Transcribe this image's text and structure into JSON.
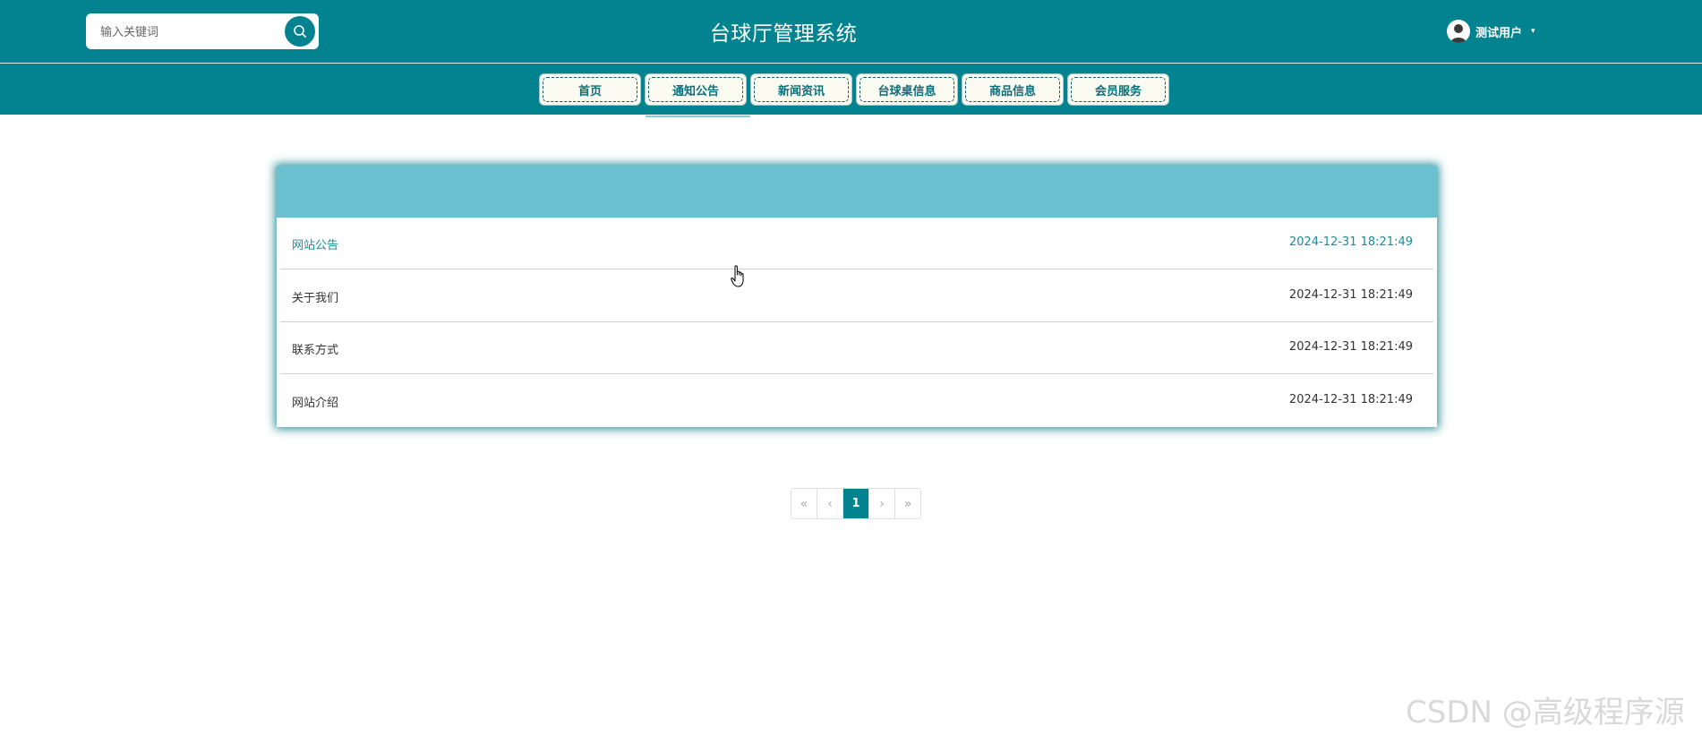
{
  "header": {
    "search_placeholder": "输入关键词",
    "title": "台球厅管理系统",
    "user_name": "测试用户",
    "caret": "▾"
  },
  "nav": {
    "items": [
      {
        "label": "首页"
      },
      {
        "label": "通知公告"
      },
      {
        "label": "新闻资讯"
      },
      {
        "label": "台球桌信息"
      },
      {
        "label": "商品信息"
      },
      {
        "label": "会员服务"
      }
    ],
    "active_index": 1
  },
  "notices": {
    "rows": [
      {
        "title": "网站公告",
        "time": "2024-12-31 18:21:49",
        "highlighted": true
      },
      {
        "title": "关于我们",
        "time": "2024-12-31 18:21:49",
        "highlighted": false
      },
      {
        "title": "联系方式",
        "time": "2024-12-31 18:21:49",
        "highlighted": false
      },
      {
        "title": "网站介绍",
        "time": "2024-12-31 18:21:49",
        "highlighted": false
      }
    ]
  },
  "pagination": {
    "first": "«",
    "prev": "‹",
    "current": "1",
    "next": "›",
    "last": "»"
  },
  "watermark": "CSDN @高级程序源",
  "colors": {
    "primary": "#03828f",
    "panel_header": "#6cc1d0",
    "nav_button_bg": "#fbfbf1",
    "active_text": "#1b8c98"
  },
  "icons": {
    "search": "search-icon",
    "avatar": "avatar",
    "cursor": "hand-cursor-icon"
  }
}
